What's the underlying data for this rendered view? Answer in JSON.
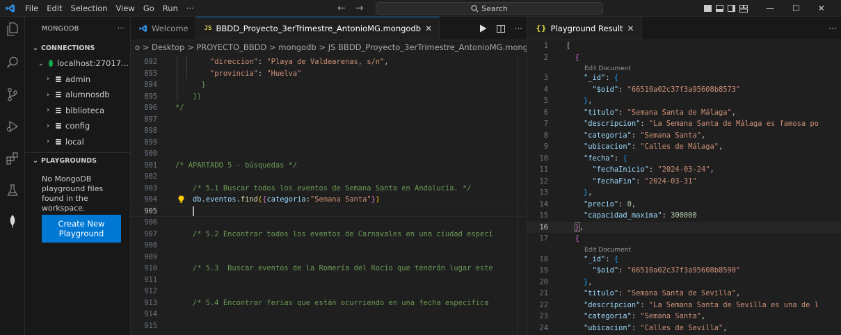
{
  "titlebar": {
    "menu": [
      "File",
      "Edit",
      "Selection",
      "View",
      "Go",
      "Run",
      "···"
    ],
    "search": "Search"
  },
  "sidebar": {
    "title": "MONGODB",
    "more": "···",
    "connections_label": "CONNECTIONS",
    "connection": "localhost:27017...",
    "databases": [
      "admin",
      "alumnosdb",
      "biblioteca",
      "config",
      "local"
    ],
    "playgrounds_label": "PLAYGROUNDS",
    "empty_note": "No MongoDB playground files found in the workspace.",
    "create_button": "Create New Playground"
  },
  "editor1": {
    "tabs": [
      {
        "label": "Welcome"
      },
      {
        "label": "BBDD_Proyecto_3erTrimestre_AntonioMG.mongodb",
        "active": true
      }
    ],
    "breadcrumb": "o > Desktop > PROYECTO_BBDD > mongodb > JS BBDD_Proyecto_3erTrimestre_AntonioMG.mongodb > ...",
    "lines": [
      {
        "n": "892",
        "text": "        \"direccion\": \"Playa de Valdearenas, s/n\","
      },
      {
        "n": "893",
        "text": "        \"provincia\": \"Huelva\""
      },
      {
        "n": "894",
        "text": "      }"
      },
      {
        "n": "895",
        "text": "    ])"
      },
      {
        "n": "896",
        "text": "*/"
      },
      {
        "n": "897",
        "text": ""
      },
      {
        "n": "898",
        "text": ""
      },
      {
        "n": "899",
        "text": ""
      },
      {
        "n": "900",
        "text": ""
      },
      {
        "n": "901",
        "text": "/* APARTADO 5 - búsquedas */"
      },
      {
        "n": "902",
        "text": ""
      },
      {
        "n": "903",
        "text": "    /* 5.1 Buscar todos los eventos de Semana Santa en Andalucía. */"
      },
      {
        "n": "904",
        "text": "    db.eventos.find({categoria:\"Semana Santa\"})"
      },
      {
        "n": "905",
        "text": ""
      },
      {
        "n": "906",
        "text": ""
      },
      {
        "n": "907",
        "text": "    /* 5.2 Encontrar todos los eventos de Carnavales en una ciudad especí"
      },
      {
        "n": "908",
        "text": ""
      },
      {
        "n": "909",
        "text": ""
      },
      {
        "n": "910",
        "text": "    /* 5.3  Buscar eventos de la Romería del Rocío que tendrán lugar este"
      },
      {
        "n": "911",
        "text": ""
      },
      {
        "n": "912",
        "text": ""
      },
      {
        "n": "913",
        "text": "    /* 5.4 Encontrar ferias que están ocurriendo en una fecha específica"
      },
      {
        "n": "914",
        "text": ""
      },
      {
        "n": "915",
        "text": ""
      }
    ]
  },
  "editor2": {
    "tab_label": "Playground Result",
    "tab_icon": "{}",
    "codelens": "Edit Document",
    "lines": [
      {
        "n": "1",
        "text": "["
      },
      {
        "n": "2",
        "text": "  {"
      },
      {
        "lens": true
      },
      {
        "n": "3",
        "text": "    \"_id\": {"
      },
      {
        "n": "4",
        "text": "      \"$oid\": \"66510a02c37f3a95608b8573\""
      },
      {
        "n": "5",
        "text": "    },"
      },
      {
        "n": "6",
        "text": "    \"titulo\": \"Semana Santa de Málaga\","
      },
      {
        "n": "7",
        "text": "    \"descripcion\": \"La Semana Santa de Málaga es famosa po"
      },
      {
        "n": "8",
        "text": "    \"categoria\": \"Semana Santa\","
      },
      {
        "n": "9",
        "text": "    \"ubicacion\": \"Calles de Málaga\","
      },
      {
        "n": "10",
        "text": "    \"fecha\": {"
      },
      {
        "n": "11",
        "text": "      \"fechaInicio\": \"2024-03-24\","
      },
      {
        "n": "12",
        "text": "      \"fechaFin\": \"2024-03-31\""
      },
      {
        "n": "13",
        "text": "    },"
      },
      {
        "n": "14",
        "text": "    \"precio\": 0,"
      },
      {
        "n": "15",
        "text": "    \"capacidad_maxima\": 300000"
      },
      {
        "n": "16",
        "text": "  },"
      },
      {
        "n": "17",
        "text": "  {"
      },
      {
        "lens": true
      },
      {
        "n": "18",
        "text": "    \"_id\": {"
      },
      {
        "n": "19",
        "text": "      \"$oid\": \"66510a02c37f3a95608b8590\""
      },
      {
        "n": "20",
        "text": "    },"
      },
      {
        "n": "21",
        "text": "    \"titulo\": \"Semana Santa de Sevilla\","
      },
      {
        "n": "22",
        "text": "    \"descripcion\": \"La Semana Santa de Sevilla es una de l"
      },
      {
        "n": "23",
        "text": "    \"categoria\": \"Semana Santa\","
      },
      {
        "n": "24",
        "text": "    \"ubicacion\": \"Calles de Sevilla\","
      }
    ]
  },
  "colors": {
    "accent": "#0078d4",
    "string": "#ce9178",
    "key": "#9cdcfe",
    "comment": "#6a9955",
    "function": "#dcdcaa"
  }
}
